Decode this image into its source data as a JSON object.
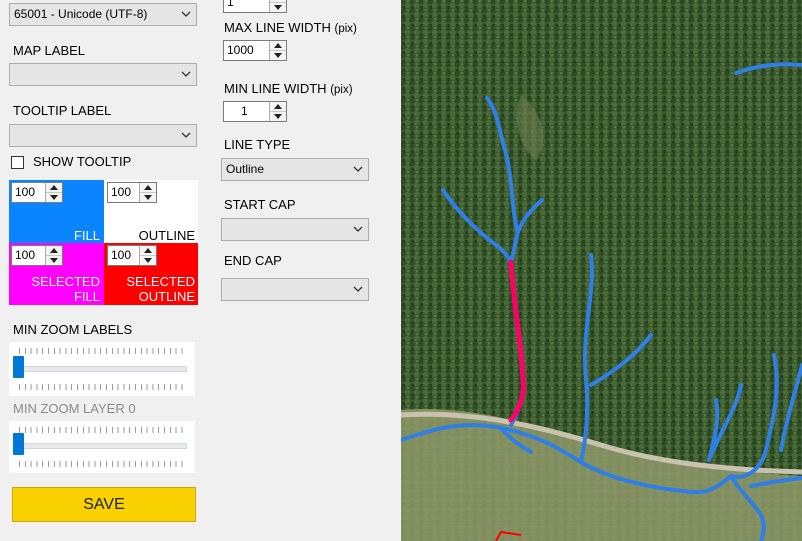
{
  "encoding_combo": {
    "value": "65001 - Unicode (UTF-8)"
  },
  "map_label": {
    "label": "MAP LABEL",
    "value": ""
  },
  "tooltip_label": {
    "label": "TOOLTIP LABEL",
    "value": ""
  },
  "show_tooltip": {
    "label": "SHOW TOOLTIP",
    "checked": false
  },
  "fill": {
    "opacity": "100",
    "label": "FILL",
    "color": "#0a84ff"
  },
  "outline": {
    "opacity": "100",
    "label": "OUTLINE",
    "color": "#ffffff"
  },
  "selected_fill": {
    "opacity": "100",
    "label_line1": "SELECTED",
    "label_line2": "FILL",
    "color": "#ff00ff"
  },
  "selected_outline": {
    "opacity": "100",
    "label_line1": "SELECTED",
    "label_line2": "OUTLINE",
    "color": "#ff0000"
  },
  "min_zoom_labels": {
    "label": "MIN ZOOM LABELS",
    "value": 0
  },
  "min_zoom_layer": {
    "label": "MIN ZOOM LAYER 0",
    "value": 0
  },
  "save_button": {
    "label": "SAVE",
    "color": "#f9d000"
  },
  "top_spinner": {
    "value": "1"
  },
  "max_line_width": {
    "label": "MAX LINE WIDTH",
    "unit": "(pix)",
    "value": "1000"
  },
  "min_line_width": {
    "label": "MIN LINE WIDTH",
    "unit": "(pix)",
    "value": "1"
  },
  "line_type": {
    "label": "LINE TYPE",
    "value": "Outline"
  },
  "start_cap": {
    "label": "START CAP",
    "value": ""
  },
  "end_cap": {
    "label": "END CAP",
    "value": ""
  },
  "map": {
    "river_color": "#2f7fe6",
    "selected_color": "#ff0066"
  }
}
